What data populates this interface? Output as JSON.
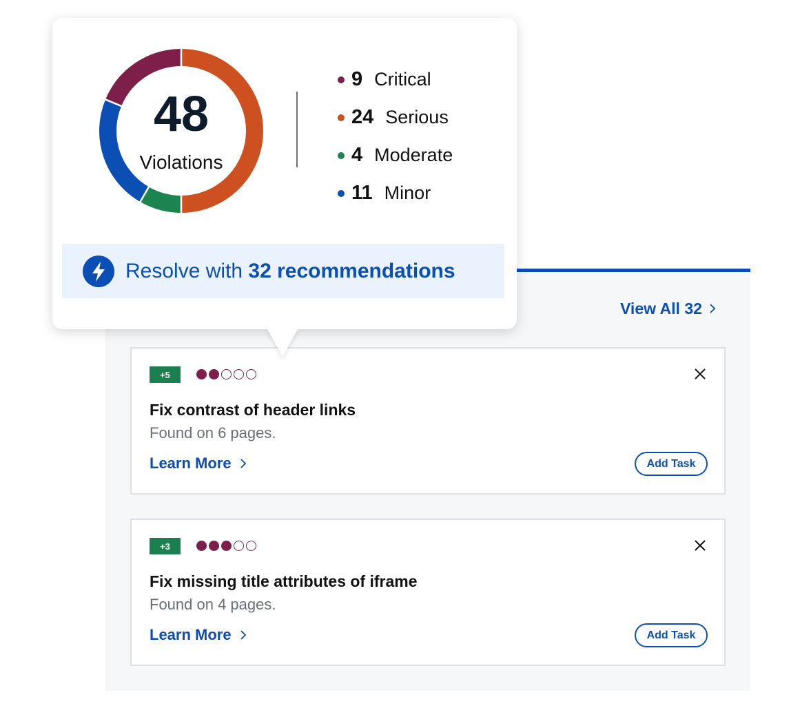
{
  "summary": {
    "total": "48",
    "total_label": "Violations",
    "segments": [
      {
        "count": "9",
        "label": "Critical",
        "value": 9,
        "color": "#7e1f4a"
      },
      {
        "count": "24",
        "label": "Serious",
        "value": 24,
        "color": "#cd5120"
      },
      {
        "count": "4",
        "label": "Moderate",
        "value": 4,
        "color": "#1b8450"
      },
      {
        "count": "11",
        "label": "Minor",
        "value": 11,
        "color": "#0b4fb5"
      }
    ]
  },
  "resolve": {
    "prefix": "Resolve with",
    "emphasis": "32 recommendations",
    "icon": "lightning-bolt-icon"
  },
  "panel": {
    "view_all": "View All 32",
    "accent_color": "#0b4fb5"
  },
  "cards": [
    {
      "badge": "+5",
      "rating_filled": 2,
      "rating_total": 5,
      "title": "Fix contrast of header links",
      "subtitle": "Found on 6 pages.",
      "learn_more": "Learn More",
      "add_task": "Add Task"
    },
    {
      "badge": "+3",
      "rating_filled": 3,
      "rating_total": 5,
      "title": "Fix missing title attributes of iframe",
      "subtitle": "Found on 4 pages.",
      "learn_more": "Learn More",
      "add_task": "Add Task"
    }
  ]
}
